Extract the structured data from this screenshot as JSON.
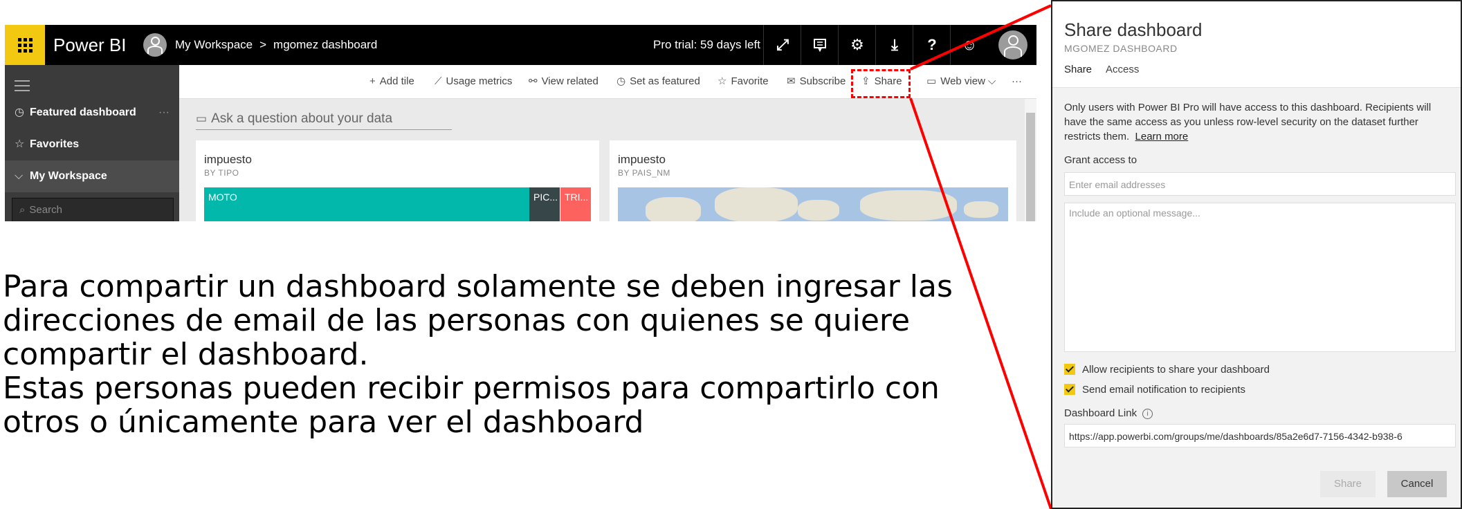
{
  "app": {
    "brand": "Power BI",
    "breadcrumb_workspace": "My Workspace",
    "breadcrumb_sep": ">",
    "breadcrumb_dashboard": "mgomez dashboard",
    "trial": "Pro trial: 59 days left",
    "icons": [
      "waffle-icon",
      "expand-icon",
      "feedback-icon",
      "gear-icon",
      "download-icon",
      "help-icon",
      "smiley-icon",
      "user-avatar-icon"
    ]
  },
  "sidebar": {
    "items": [
      {
        "label": "Featured dashboard",
        "icon": "featured-icon"
      },
      {
        "label": "Favorites",
        "icon": "star-icon"
      },
      {
        "label": "My Workspace",
        "icon": "chevron-down-icon"
      }
    ],
    "more": "···",
    "search_placeholder": "Search"
  },
  "commands": [
    {
      "label": "Add tile",
      "glyph": "+"
    },
    {
      "label": "Usage metrics",
      "glyph": "⟋"
    },
    {
      "label": "View related",
      "glyph": "⚯"
    },
    {
      "label": "Set as featured",
      "glyph": "◷"
    },
    {
      "label": "Favorite",
      "glyph": "☆"
    },
    {
      "label": "Subscribe",
      "glyph": "✉"
    },
    {
      "label": "Share",
      "glyph": "⇪"
    },
    {
      "label": "Web view",
      "glyph": "▭"
    }
  ],
  "cmd_more": "···",
  "qna_placeholder": "Ask a question about your data",
  "tiles": [
    {
      "title": "impuesto",
      "subtitle": "BY TIPO",
      "bars": [
        "MOTO",
        "PIC...",
        "TRI..."
      ]
    },
    {
      "title": "impuesto",
      "subtitle": "BY PAIS_NM"
    }
  ],
  "caption": {
    "line1": "Para compartir un dashboard solamente se deben ingresar las",
    "line2": "direcciones de email de las personas con quienes se quiere",
    "line3": "compartir el dashboard.",
    "line4": "Estas personas pueden recibir permisos para compartirlo con",
    "line5": "otros o únicamente para ver el dashboard"
  },
  "dialog": {
    "title": "Share dashboard",
    "subtitle": "MGOMEZ DASHBOARD",
    "tab_share": "Share",
    "tab_access": "Access",
    "info": "Only users with Power BI Pro will have access to this dashboard. Recipients will have the same access as you unless row-level security on the dataset further restricts them.",
    "learn_more": "Learn more",
    "grant_label": "Grant access to",
    "email_placeholder": "Enter email addresses",
    "message_placeholder": "Include an optional message...",
    "allow_share": "Allow recipients to share your dashboard",
    "send_email": "Send email notification to recipients",
    "link_label": "Dashboard Link",
    "link": "https://app.powerbi.com/groups/me/dashboards/85a2e6d7-7156-4342-b938-6",
    "share_button": "Share",
    "cancel_button": "Cancel"
  },
  "colors": {
    "accent_yellow": "#f2c811",
    "teal_bar": "#01b8aa",
    "dark_bar": "#374649",
    "red_bar": "#fd625e",
    "annotation_red": "#ff0000"
  }
}
